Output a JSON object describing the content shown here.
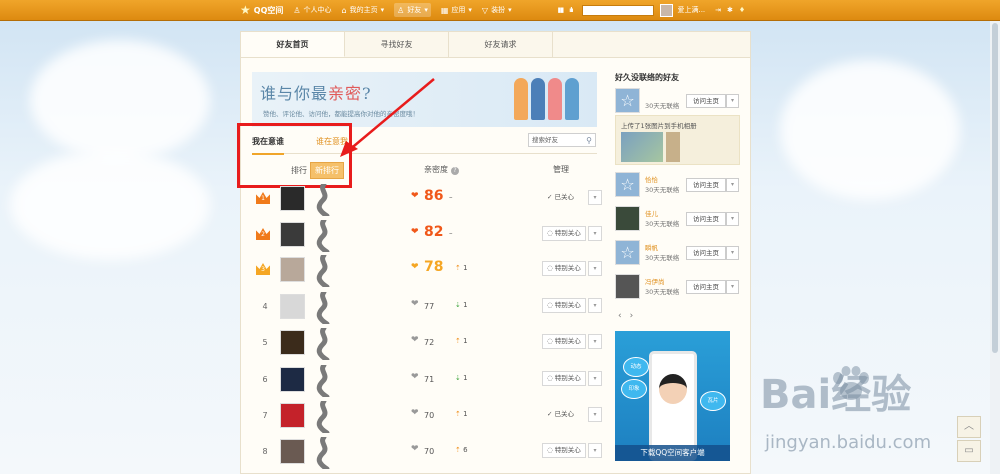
{
  "topbar": {
    "logo": "QQ空间",
    "personal_center": "个人中心",
    "my_home": "我的主页",
    "friends": "好友",
    "apps": "应用",
    "decor": "装扮",
    "pause": "▮▮",
    "user_name": "爱上满..."
  },
  "tabs": [
    "好友首页",
    "寻找好友",
    "好友请求"
  ],
  "banner": {
    "title_a": "谁与你最",
    "title_hl": "亲密",
    "title_b": "?",
    "subtitle": "赞他、评论他、访问他，都能提高你对他的亲密度哦！"
  },
  "subtabs": {
    "in_mind": "我在意谁",
    "cares_me": "谁在意我"
  },
  "search": {
    "placeholder": "搜索好友"
  },
  "sort": {
    "label": "排行",
    "button": "新排行"
  },
  "columns": {
    "intimacy": "亲密度",
    "manage": "管理"
  },
  "friends": [
    {
      "rank": "1",
      "score": "86",
      "change": "–",
      "dir": "",
      "status": "已关心",
      "avatar_color": "#2a2a2a"
    },
    {
      "rank": "2",
      "score": "82",
      "change": "–",
      "dir": "",
      "status": "特别关心",
      "avatar_color": "#3a3a3a"
    },
    {
      "rank": "3",
      "score": "78",
      "change": "1",
      "dir": "up",
      "status": "特别关心",
      "avatar_color": "#b8a89a"
    },
    {
      "rank": "4",
      "score": "77",
      "change": "1",
      "dir": "down",
      "status": "特别关心",
      "avatar_color": "#d8d8d8"
    },
    {
      "rank": "5",
      "score": "72",
      "change": "1",
      "dir": "up",
      "status": "特别关心",
      "avatar_color": "#3b2b1b"
    },
    {
      "rank": "6",
      "score": "71",
      "change": "1",
      "dir": "down",
      "status": "特别关心",
      "avatar_color": "#1d2a44"
    },
    {
      "rank": "7",
      "score": "70",
      "change": "1",
      "dir": "up",
      "status": "已关心",
      "avatar_color": "#c4222a"
    },
    {
      "rank": "8",
      "score": "70",
      "change": "6",
      "dir": "up",
      "status": "特别关心",
      "avatar_color": "#6a5a52"
    }
  ],
  "right": {
    "title": "好久没联络的好友",
    "visit_label": "访问主页",
    "days_label": "30天无联络",
    "feed_text": "上传了1张图片到手机相册",
    "contacts": [
      {
        "name": "",
        "avatar_color": "#8fb4d6",
        "default": true
      },
      {
        "name": "恰恰",
        "avatar_color": "#8fb4d6",
        "default": true
      },
      {
        "name": "佳儿",
        "avatar_color": "#3a4a3a",
        "default": false
      },
      {
        "name": "瞬帆",
        "avatar_color": "#8fb4d6",
        "default": true
      },
      {
        "name": "冯伊尚",
        "avatar_color": "#555555",
        "default": false
      }
    ],
    "ad_text": "下载QQ空间客户端",
    "ad_bubble_1": "动态",
    "ad_bubble_2": "印象",
    "ad_bubble_3": "瓦片"
  },
  "watermark": {
    "text": "Bai经验",
    "url": "jingyan.baidu.com"
  }
}
